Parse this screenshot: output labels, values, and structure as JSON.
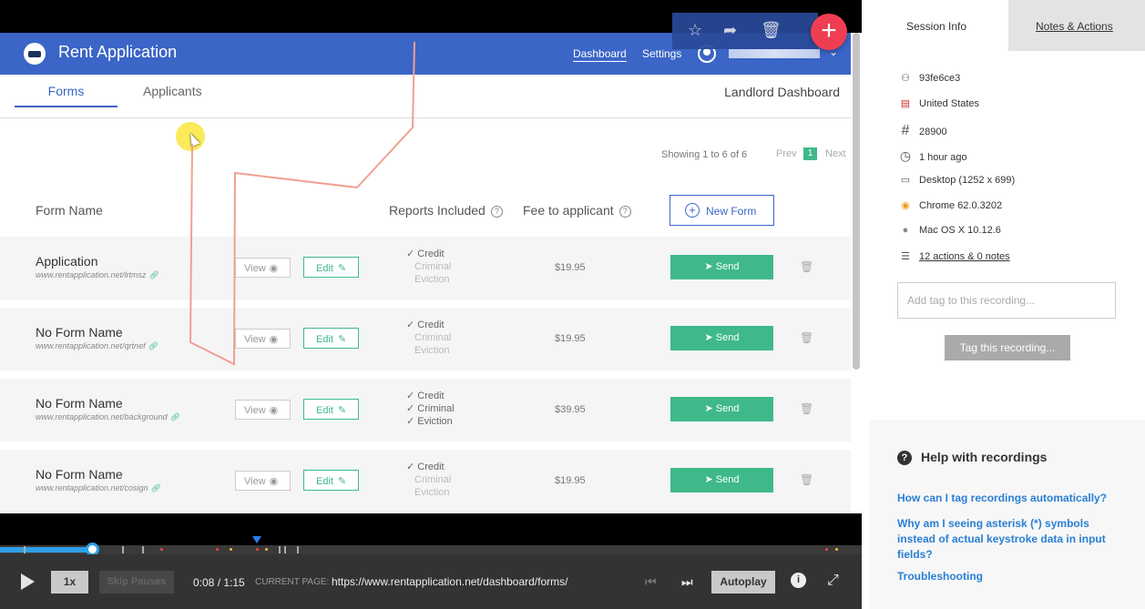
{
  "app": {
    "title": "Rent Application",
    "nav_dashboard": "Dashboard",
    "nav_settings": "Settings",
    "caret": "⌄"
  },
  "subnav": {
    "tab_forms": "Forms",
    "tab_applicants": "Applicants",
    "landlord_dashboard": "Landlord Dashboard"
  },
  "pagination": {
    "info": "Showing 1 to 6 of 6",
    "prev": "Prev",
    "page": "1",
    "next": "Next"
  },
  "table": {
    "col_form_name": "Form Name",
    "col_reports": "Reports Included",
    "col_fee": "Fee to applicant",
    "help_mark": "?",
    "new_form_label": "New Form",
    "new_form_plus": "+",
    "view_label": "View",
    "edit_label": "Edit",
    "send_label": "Send",
    "rows": [
      {
        "name": "Application",
        "url": "www.rentapplication.net/lrtmsz",
        "credit": "✓ Credit",
        "criminal": "Criminal",
        "eviction": "Eviction",
        "criminal_on": false,
        "eviction_on": false,
        "fee": "$19.95"
      },
      {
        "name": "No Form Name",
        "url": "www.rentapplication.net/qrtnef",
        "credit": "✓ Credit",
        "criminal": "Criminal",
        "eviction": "Eviction",
        "criminal_on": false,
        "eviction_on": false,
        "fee": "$19.95"
      },
      {
        "name": "No Form Name",
        "url": "www.rentapplication.net/background",
        "credit": "✓ Credit",
        "criminal": "✓ Criminal",
        "eviction": "✓ Eviction",
        "criminal_on": true,
        "eviction_on": true,
        "fee": "$39.95"
      },
      {
        "name": "No Form Name",
        "url": "www.rentapplication.net/cosign",
        "credit": "✓ Credit",
        "criminal": "Criminal",
        "eviction": "Eviction",
        "criminal_on": false,
        "eviction_on": false,
        "fee": "$19.95"
      }
    ]
  },
  "player": {
    "speed": "1x",
    "skip_pauses": "Skip Pauses",
    "time": "0:08 / 1:15",
    "current_page_label": "CURRENT PAGE:",
    "current_page_url": "https://www.rentapplication.net/dashboard/forms/",
    "autoplay": "Autoplay",
    "info": "i",
    "progress": 0.107
  },
  "side": {
    "tab_session": "Session Info",
    "tab_notes": "Notes & Actions",
    "user_id": "93fe6ce3",
    "country": "United States",
    "number": "28900",
    "time_ago": "1 hour ago",
    "device": "Desktop (1252 x 699)",
    "browser": "Chrome 62.0.3202",
    "os": "Mac OS X 10.12.6",
    "actions": "12 actions & 0 notes",
    "tag_placeholder": "Add tag to this recording...",
    "tag_button": "Tag this recording...",
    "help_title": "Help with recordings",
    "help_q": "?",
    "help_links": [
      "How can I tag recordings automatically?",
      "Why am I seeing asterisk (*) symbols instead of actual keystroke data in input fields?",
      "Troubleshooting"
    ]
  },
  "icons": {
    "user": "user-icon",
    "flag": "us-flag-icon",
    "hash": "hash-icon",
    "clock": "clock-icon",
    "monitor": "monitor-icon",
    "chrome": "chrome-icon",
    "apple": "apple-icon",
    "list": "list-icon"
  },
  "colors": {
    "brand_blue": "#3b65c6",
    "send_green": "#3fb98a",
    "fab_red": "#ef3e52",
    "link_blue": "#2a7fd4",
    "timeline_blue": "#2e9fe6"
  }
}
